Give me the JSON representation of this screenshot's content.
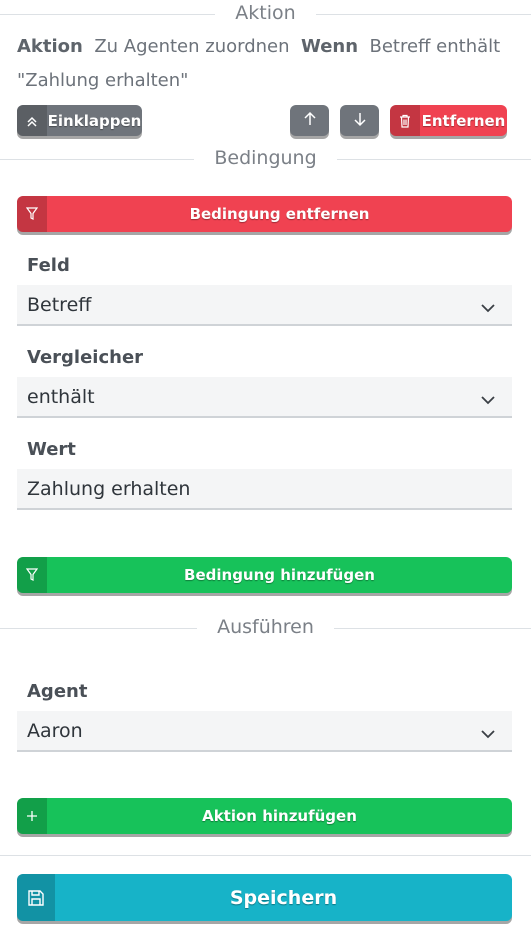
{
  "action_section": {
    "title": "Aktion",
    "summary": {
      "kw_action": "Aktion",
      "action_text": "Zu Agenten zuordnen",
      "kw_when": "Wenn",
      "condition_text": "Betreff enthält",
      "value_text": "\"Zahlung erhalten\""
    },
    "collapse_label": "Einklappen",
    "remove_label": "Entfernen"
  },
  "condition_section": {
    "title": "Bedingung",
    "remove_condition_label": "Bedingung entfernen",
    "field_label": "Feld",
    "field_value": "Betreff",
    "comparator_label": "Vergleicher",
    "comparator_value": "enthält",
    "value_label": "Wert",
    "value_value": "Zahlung erhalten",
    "add_condition_label": "Bedingung hinzufügen"
  },
  "execute_section": {
    "title": "Ausführen",
    "agent_label": "Agent",
    "agent_value": "Aaron",
    "add_action_label": "Aktion hinzufügen"
  },
  "footer": {
    "save_label": "Speichern"
  },
  "colors": {
    "danger": "#f04251",
    "success": "#17c25a",
    "primary": "#17b3c8",
    "secondary": "#6f747b"
  }
}
